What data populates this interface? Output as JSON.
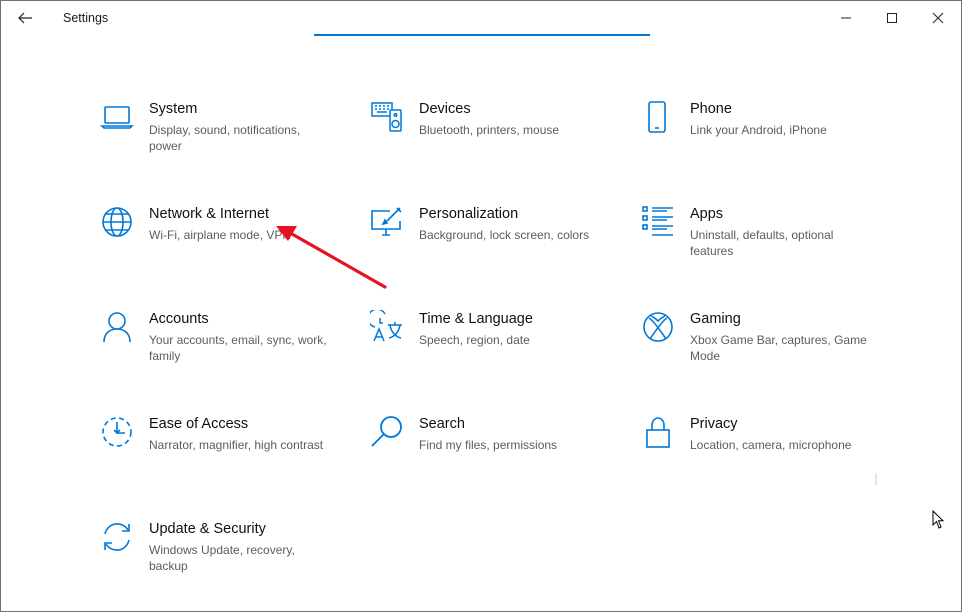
{
  "window": {
    "title": "Settings"
  },
  "colors": {
    "accent": "#0078d7",
    "annotation": "#e81123"
  },
  "categories": [
    {
      "id": "system",
      "icon": "laptop-icon",
      "name": "System",
      "desc": "Display, sound, notifications, power"
    },
    {
      "id": "devices",
      "icon": "keyboard-speaker-icon",
      "name": "Devices",
      "desc": "Bluetooth, printers, mouse"
    },
    {
      "id": "phone",
      "icon": "phone-icon",
      "name": "Phone",
      "desc": "Link your Android, iPhone"
    },
    {
      "id": "network",
      "icon": "globe-icon",
      "name": "Network & Internet",
      "desc": "Wi-Fi, airplane mode, VPN"
    },
    {
      "id": "personalization",
      "icon": "paint-brush-display-icon",
      "name": "Personalization",
      "desc": "Background, lock screen, colors"
    },
    {
      "id": "apps",
      "icon": "apps-list-icon",
      "name": "Apps",
      "desc": "Uninstall, defaults, optional features"
    },
    {
      "id": "accounts",
      "icon": "person-icon",
      "name": "Accounts",
      "desc": "Your accounts, email, sync, work, family"
    },
    {
      "id": "time-language",
      "icon": "time-language-icon",
      "name": "Time & Language",
      "desc": "Speech, region, date"
    },
    {
      "id": "gaming",
      "icon": "xbox-icon",
      "name": "Gaming",
      "desc": "Xbox Game Bar, captures, Game Mode"
    },
    {
      "id": "ease-of-access",
      "icon": "ease-of-access-icon",
      "name": "Ease of Access",
      "desc": "Narrator, magnifier, high contrast"
    },
    {
      "id": "search",
      "icon": "magnifier-icon",
      "name": "Search",
      "desc": "Find my files, permissions"
    },
    {
      "id": "privacy",
      "icon": "lock-icon",
      "name": "Privacy",
      "desc": "Location, camera, microphone"
    },
    {
      "id": "update-security",
      "icon": "sync-arrows-icon",
      "name": "Update & Security",
      "desc": "Windows Update, recovery, backup"
    }
  ]
}
